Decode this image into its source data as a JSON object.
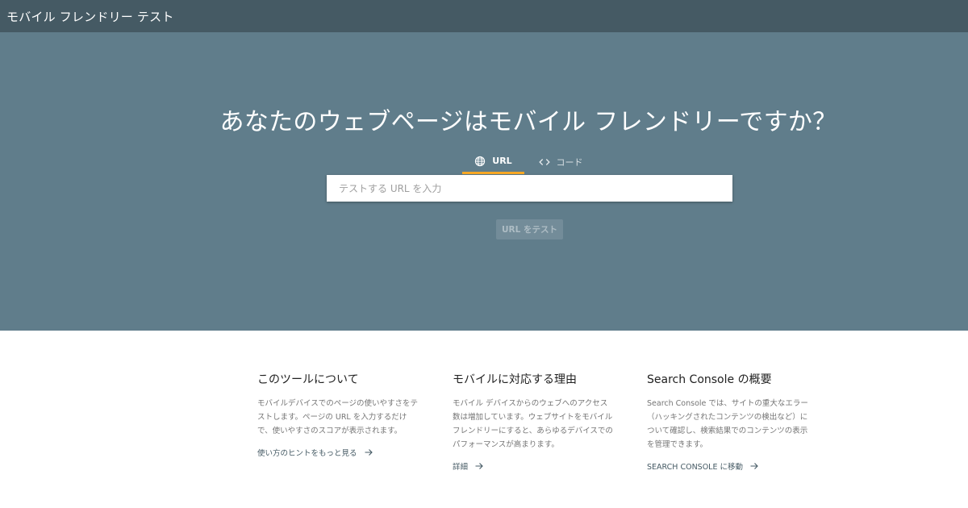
{
  "header": {
    "title": "モバイル フレンドリー テスト"
  },
  "hero": {
    "headline": "あなたのウェブページはモバイル フレンドリーですか？",
    "tabs": [
      {
        "label": "URL",
        "icon": "globe-icon",
        "active": true
      },
      {
        "label": "コード",
        "icon": "code-icon",
        "active": false
      }
    ],
    "input_placeholder": "テストする URL を入力",
    "test_button": "URL をテスト"
  },
  "sections": [
    {
      "title": "このツールについて",
      "body": "モバイルデバイスでのページの使いやすさをテストします。ページの URL を入力するだけで、使いやすさのスコアが表示されます。",
      "link": "使い方のヒントをもっと見る"
    },
    {
      "title": "モバイルに対応する理由",
      "body": "モバイル デバイスからのウェブへのアクセス数は増加しています。ウェブサイトをモバイル フレンドリーにすると、あらゆるデバイスでのパフォーマンスが高まります。",
      "link": "詳細"
    },
    {
      "title": "Search Console の概要",
      "body": "Search Console では、サイトの重大なエラー（ハッキングされたコンテンツの検出など）について確認し、検索結果でのコンテンツの表示を管理できます。",
      "link": "SEARCH CONSOLE に移動"
    }
  ],
  "colors": {
    "topbar": "#455a64",
    "hero": "#607d8b",
    "tab_indicator": "#f9a825",
    "link": "#455a64"
  }
}
